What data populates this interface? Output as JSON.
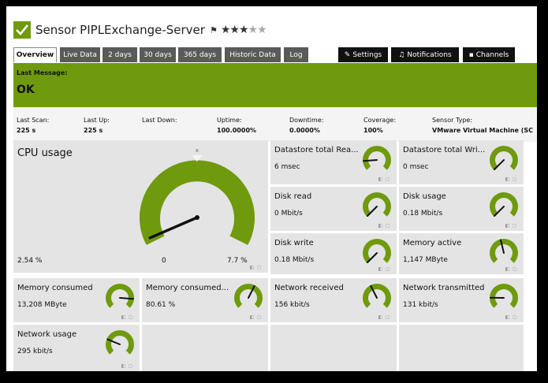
{
  "header": {
    "title": "Sensor PIPLExchange-Server",
    "flag_glyph": "⚑",
    "rating": 3,
    "max_rating": 5
  },
  "tabs": [
    {
      "label": "Overview",
      "active": true
    },
    {
      "label": "Live Data"
    },
    {
      "label": "2 days"
    },
    {
      "label": "30 days"
    },
    {
      "label": "365 days"
    },
    {
      "label": "Historic Data"
    },
    {
      "label": "Log"
    }
  ],
  "action_tabs": [
    {
      "label": "Settings",
      "icon": "wrench-icon"
    },
    {
      "label": "Notifications",
      "icon": "bell-icon"
    },
    {
      "label": "Channels",
      "icon": "bar-chart-icon"
    }
  ],
  "last_message": {
    "label": "Last Message:",
    "value": "OK"
  },
  "stats": [
    {
      "label": "Last Scan:",
      "value": "225 s"
    },
    {
      "label": "Last Up:",
      "value": "225 s"
    },
    {
      "label": "Last Down:",
      "value": ""
    },
    {
      "label": "Uptime:",
      "value": "100.0000%"
    },
    {
      "label": "Downtime:",
      "value": "0.0000%"
    },
    {
      "label": "Coverage:",
      "value": "100%"
    },
    {
      "label": "Sensor Type:",
      "value": "VMware Virtual Machine (SC"
    }
  ],
  "cpu": {
    "title": "CPU usage",
    "value": "2.54 %",
    "min": "0",
    "max": "7.7 %",
    "needle_fraction": 0.08
  },
  "tiles": [
    {
      "title": "Datastore total Rea...",
      "value": "6 msec",
      "needle": 0.15
    },
    {
      "title": "Datastore total Wri...",
      "value": "0 msec",
      "needle": 0.0
    },
    {
      "title": "Disk read",
      "value": "0 Mbit/s",
      "needle": 0.0
    },
    {
      "title": "Disk usage",
      "value": "0.18 Mbit/s",
      "needle": 0.0
    },
    {
      "title": "Disk write",
      "value": "0.18 Mbit/s",
      "needle": 0.0
    },
    {
      "title": "Memory active",
      "value": "1,147 MByte",
      "needle": 0.45
    },
    {
      "title": "Memory consumed",
      "value": "13,208 MByte",
      "needle": 0.85
    },
    {
      "title": "Memory consumed...",
      "value": "80.61 %",
      "needle": 0.6
    },
    {
      "title": "Network received",
      "value": "156 kbit/s",
      "needle": 0.4
    },
    {
      "title": "Network transmitted",
      "value": "131 kbit/s",
      "needle": 0.17
    },
    {
      "title": "Network usage",
      "value": "295 kbit/s",
      "needle": 0.25
    }
  ],
  "colors": {
    "accent": "#6f9a0d",
    "tile_bg": "#e4e4e4",
    "tab_bg": "#5a5a5a",
    "needle": "#111111"
  }
}
